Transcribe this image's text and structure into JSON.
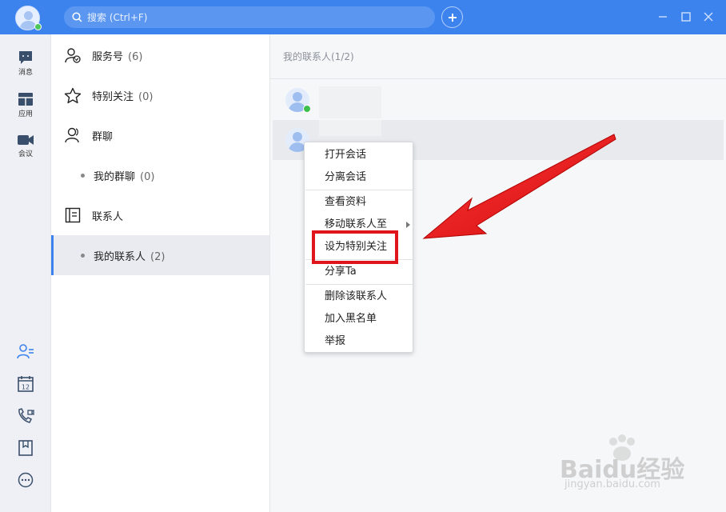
{
  "search": {
    "placeholder": "搜索 (Ctrl+F)"
  },
  "nav": {
    "messages": "消息",
    "apps": "应用",
    "meeting": "会议"
  },
  "middle": {
    "items": [
      {
        "label": "服务号",
        "count": "(6)"
      },
      {
        "label": "特别关注",
        "count": "(0)"
      },
      {
        "label": "群聊",
        "count": ""
      },
      {
        "label": "我的群聊",
        "count": "(0)"
      },
      {
        "label": "联系人",
        "count": ""
      },
      {
        "label": "我的联系人",
        "count": "(2)"
      }
    ]
  },
  "right": {
    "header": "我的联系人(1/2)"
  },
  "context_menu": {
    "items": [
      "打开会话",
      "分离会话",
      "查看资料",
      "移动联系人至",
      "设为特别关注",
      "分享Ta",
      "删除该联系人",
      "加入黑名单",
      "举报"
    ]
  },
  "watermark": {
    "brand": "Baidu经验",
    "url": "jingyan.baidu.com"
  },
  "colors": {
    "accent": "#3d83ee",
    "highlight": "#e0141b",
    "online": "#3dbf4d"
  }
}
